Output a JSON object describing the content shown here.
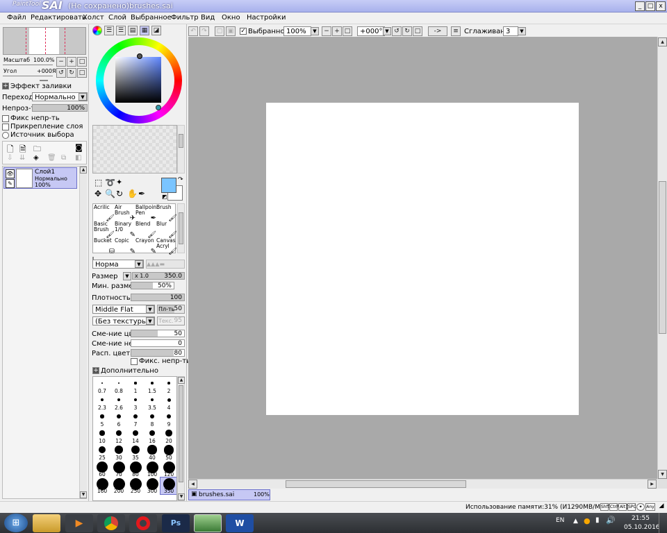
{
  "window": {
    "logo_small": "PaintTool",
    "logo_big": "SAI",
    "title": "(Не сохранено)brushes.sai",
    "min_label": "_",
    "max_label": "□",
    "close_label": "x"
  },
  "menu": [
    "Файл",
    "Редактировать",
    "Холст",
    "Слой",
    "Выбранное",
    "Фильтр",
    "Вид",
    "Окно",
    "Настройки"
  ],
  "toolbar": {
    "selection_label": "Выбранное",
    "zoom_value": "100%",
    "rotation_value": "+000°",
    "flip_label": "->",
    "smoothing_label": "Сглаживание",
    "smoothing_value": "3"
  },
  "navigator": {
    "zoom_label": "Масштаб",
    "zoom_value": "100.0%",
    "angle_label": "Угол",
    "angle_value": "+000Я"
  },
  "layer_panel": {
    "fill_effect_label": "Эффект заливки",
    "blend_label": "Переход",
    "blend_value": "Нормально",
    "opacity_label": "Непроз-ть",
    "opacity_value": "100%",
    "opacity_fraction": 1.0,
    "checkboxes": [
      "Фикс непр-ть",
      "Прикрепление слоя",
      "Источник выбора"
    ],
    "layer": {
      "name": "Слой1",
      "mode": "Нормально",
      "opacity": "100%"
    }
  },
  "brushes": [
    {
      "name": "Acrilic"
    },
    {
      "name": "Air Brush"
    },
    {
      "name": "Ballpoint Pen"
    },
    {
      "name": "Brush"
    },
    {
      "name": "Basic Brush"
    },
    {
      "name": "Binary 1/0"
    },
    {
      "name": "Blend"
    },
    {
      "name": "Blur"
    },
    {
      "name": "Bucket"
    },
    {
      "name": "Copic"
    },
    {
      "name": "Crayon"
    },
    {
      "name": "Canvas Acryl"
    }
  ],
  "brush_settings": {
    "mode_value": "Норма",
    "size_label": "Размер",
    "size_multiplier": "x 1.0",
    "size_value": "350.0",
    "min_size_label": "Мин. размер",
    "min_size_value": "50%",
    "min_size_fraction": 0.5,
    "density_label": "Плотность",
    "density_value": "100",
    "density_fraction": 1.0,
    "shape_value": "Middle Flat",
    "shape_amount_label": "Пл-ть",
    "shape_amount_value": "50",
    "texture_value": "(Без текстуры)",
    "texture_amount_label": "Текс.",
    "texture_amount_value": "95",
    "mix_color_label": "Сме-ние цв.",
    "mix_color_value": "50",
    "mix_color_fraction": 0.5,
    "mix_opacity_label": "Сме-ние непр.",
    "mix_opacity_value": "0",
    "mix_opacity_fraction": 0.0,
    "spread_label": "Расп. цвета",
    "spread_value": "80",
    "spread_fraction": 0.8,
    "fix_opacity_label": "Фикс. непр-ть",
    "advanced_label": "Дополнительно"
  },
  "brush_sizes": [
    "0.7",
    "0.8",
    "1",
    "1.5",
    "2",
    "2.3",
    "2.6",
    "3",
    "3.5",
    "4",
    "5",
    "6",
    "7",
    "8",
    "9",
    "10",
    "12",
    "14",
    "16",
    "20",
    "25",
    "30",
    "35",
    "40",
    "50",
    "60",
    "70",
    "80",
    "100",
    "120",
    "160",
    "200",
    "250",
    "300",
    "350"
  ],
  "selected_brush_size": "350",
  "tab": {
    "name": "brushes.sai",
    "zoom": "100%"
  },
  "status": {
    "memory": "Использование памяти:31% (И1290MB/M4077MB)",
    "keys": [
      "Shft",
      "Ctrl",
      "Alt",
      "SPC",
      "Any"
    ]
  },
  "taskbar": {
    "lang": "EN",
    "time": "21:55",
    "date": "05.10.2016"
  },
  "colors": {
    "accent": "#b5b8f0",
    "fg_color": "#7ac4ff",
    "bg_color": "#ffffff",
    "canvas_bg": "#a9a9a9"
  }
}
